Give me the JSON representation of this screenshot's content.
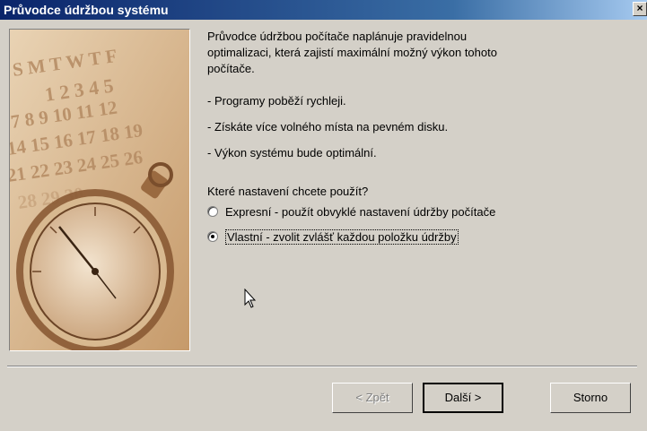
{
  "window": {
    "title": "Průvodce údržbou systému",
    "close_label": "×"
  },
  "intro": {
    "line1": "Průvodce údržbou počítače naplánuje pravidelnou",
    "line2": "optimalizaci, která zajistí maximální možný výkon tohoto",
    "line3": "počítače."
  },
  "benefits": [
    "- Programy poběží rychleji.",
    "- Získáte více volného místa na pevném disku.",
    "- Výkon systému bude optimální."
  ],
  "question": "Které nastavení chcete použít?",
  "options": [
    {
      "label": "Expresní - použít obvyklé nastavení údržby počítače",
      "checked": false
    },
    {
      "label": "Vlastní - zvolit zvlášť každou položku údržby",
      "checked": true
    }
  ],
  "buttons": {
    "back": "< Zpět",
    "next": "Další >",
    "cancel": "Storno"
  },
  "calendar": {
    "rows": [
      "S M T W T F",
      "1 2 3 4 5",
      "7 8 9 10 11 12",
      "14 15 16 17 18 19",
      "21 22 23 24 25 26",
      "28 29 30"
    ]
  }
}
